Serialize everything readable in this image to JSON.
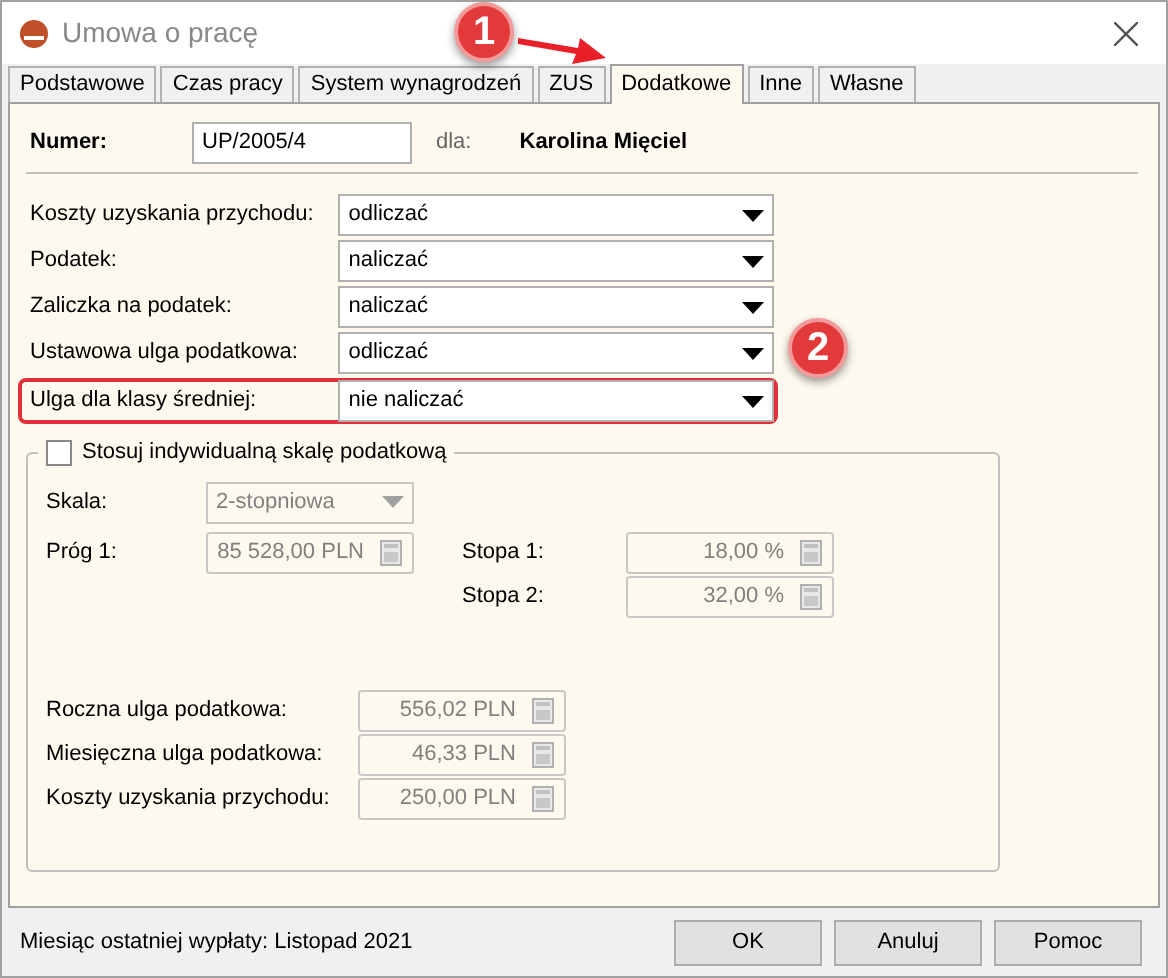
{
  "window": {
    "title": "Umowa o pracę"
  },
  "tabs": [
    {
      "label": "Podstawowe",
      "selected": false
    },
    {
      "label": "Czas pracy",
      "selected": false
    },
    {
      "label": "System wynagrodzeń",
      "selected": false
    },
    {
      "label": "ZUS",
      "selected": false
    },
    {
      "label": "Dodatkowe",
      "selected": true
    },
    {
      "label": "Inne",
      "selected": false
    },
    {
      "label": "Własne",
      "selected": false
    }
  ],
  "header": {
    "number_label": "Numer:",
    "number_value": "UP/2005/4",
    "for_label": "dla:",
    "employee": "Karolina Mięciel"
  },
  "settings": [
    {
      "label": "Koszty uzyskania przychodu:",
      "value": "odliczać",
      "highlighted": false
    },
    {
      "label": "Podatek:",
      "value": "naliczać",
      "highlighted": false
    },
    {
      "label": "Zaliczka na podatek:",
      "value": "naliczać",
      "highlighted": false
    },
    {
      "label": "Ustawowa ulga podatkowa:",
      "value": "odliczać",
      "highlighted": false
    },
    {
      "label": "Ulga dla klasy średniej:",
      "value": "nie naliczać",
      "highlighted": true
    }
  ],
  "tax_scale": {
    "checkbox_label": "Stosuj indywidualną skalę podatkową",
    "checked": false,
    "disabled": true,
    "scale_label": "Skala:",
    "scale_value": "2-stopniowa",
    "threshold_label": "Próg 1:",
    "threshold_value": "85 528,00 PLN",
    "rates": [
      {
        "label": "Stopa 1:",
        "value": "18,00 %"
      },
      {
        "label": "Stopa 2:",
        "value": "32,00 %"
      }
    ],
    "amounts": [
      {
        "label": "Roczna ulga podatkowa:",
        "value": "556,02 PLN"
      },
      {
        "label": "Miesięczna ulga podatkowa:",
        "value": "46,33 PLN"
      },
      {
        "label": "Koszty uzyskania przychodu:",
        "value": "250,00 PLN"
      }
    ]
  },
  "status": "Miesiąc ostatniej wypłaty: Listopad 2021",
  "buttons": [
    "OK",
    "Anuluj",
    "Pomoc"
  ],
  "annotations": [
    "1",
    "2"
  ]
}
